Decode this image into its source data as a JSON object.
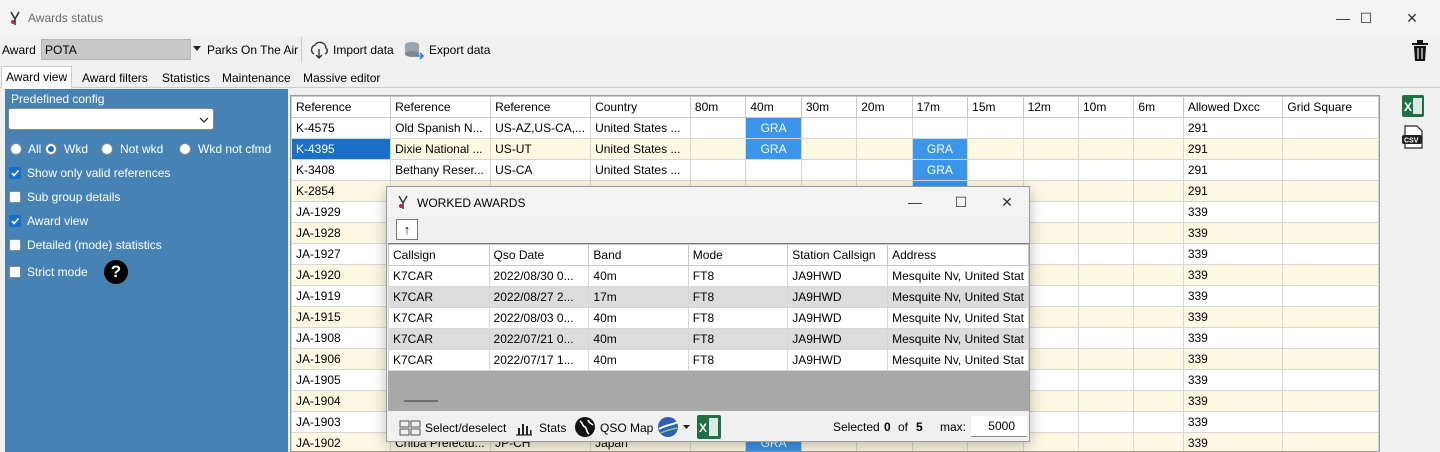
{
  "window": {
    "title": "Awards status",
    "minimize": "—",
    "maximize": "☐",
    "close": "✕"
  },
  "award_bar": {
    "label": "Award",
    "value": "POTA",
    "name": "Parks On The Air",
    "import_label": "Import data",
    "export_label": "Export data"
  },
  "tabs": [
    "Award view",
    "Award filters",
    "Statistics",
    "Maintenance",
    "Massive editor"
  ],
  "left_panel": {
    "predefined_label": "Predefined config",
    "predefined_value": "",
    "radio_all": "All",
    "radio_wkd": "Wkd",
    "radio_not_wkd": "Not wkd",
    "radio_not_cfmd": "Wkd not cfmd",
    "options": [
      {
        "label": "Show only valid references",
        "checked": true
      },
      {
        "label": "Sub group details",
        "checked": false
      },
      {
        "label": "Award view",
        "checked": true
      },
      {
        "label": "Detailed (mode) statistics",
        "checked": false
      },
      {
        "label": "Strict mode",
        "checked": false
      }
    ],
    "help_glyph": "?"
  },
  "grid": {
    "columns": [
      "Reference",
      "Reference",
      "Reference",
      "Country",
      "80m",
      "40m",
      "30m",
      "20m",
      "17m",
      "15m",
      "12m",
      "10m",
      "6m",
      "Allowed Dxcc",
      "Grid Square"
    ],
    "rows": [
      [
        "K-4575",
        "Old Spanish N...",
        "US-AZ,US-CA,...",
        "United States ...",
        "",
        "GRA",
        "",
        "",
        "",
        "",
        "",
        "",
        "",
        "291",
        ""
      ],
      [
        "K-4395",
        "Dixie National ...",
        "US-UT",
        "United States ...",
        "",
        "GRA",
        "",
        "",
        "GRA",
        "",
        "",
        "",
        "",
        "291",
        ""
      ],
      [
        "K-3408",
        "Bethany Reser...",
        "US-CA",
        "United States ...",
        "",
        "",
        "",
        "",
        "GRA",
        "",
        "",
        "",
        "",
        "291",
        ""
      ],
      [
        "K-2854",
        "",
        "",
        "",
        "",
        "",
        "",
        "",
        "GRA",
        "",
        "",
        "",
        "",
        "291",
        ""
      ],
      [
        "JA-1929",
        "",
        "",
        "",
        "",
        "",
        "",
        "",
        "",
        "",
        "",
        "",
        "",
        "339",
        ""
      ],
      [
        "JA-1928",
        "",
        "",
        "",
        "",
        "",
        "",
        "",
        "",
        "",
        "",
        "",
        "",
        "339",
        ""
      ],
      [
        "JA-1927",
        "",
        "",
        "",
        "",
        "",
        "",
        "",
        "",
        "",
        "",
        "",
        "",
        "339",
        ""
      ],
      [
        "JA-1920",
        "",
        "",
        "",
        "",
        "",
        "",
        "",
        "",
        "",
        "",
        "",
        "",
        "339",
        ""
      ],
      [
        "JA-1919",
        "",
        "",
        "",
        "",
        "",
        "",
        "",
        "",
        "",
        "",
        "",
        "",
        "339",
        ""
      ],
      [
        "JA-1915",
        "",
        "",
        "",
        "",
        "",
        "",
        "",
        "",
        "",
        "",
        "",
        "",
        "339",
        ""
      ],
      [
        "JA-1908",
        "",
        "",
        "",
        "",
        "",
        "",
        "",
        "",
        "",
        "",
        "",
        "",
        "339",
        ""
      ],
      [
        "JA-1906",
        "",
        "",
        "",
        "",
        "",
        "",
        "",
        "",
        "",
        "",
        "",
        "",
        "339",
        ""
      ],
      [
        "JA-1905",
        "",
        "",
        "",
        "",
        "",
        "",
        "",
        "",
        "",
        "",
        "",
        "",
        "339",
        ""
      ],
      [
        "JA-1904",
        "",
        "",
        "",
        "",
        "",
        "",
        "",
        "",
        "",
        "",
        "",
        "",
        "339",
        ""
      ],
      [
        "JA-1903",
        "",
        "",
        "",
        "",
        "",
        "",
        "",
        "",
        "",
        "",
        "",
        "",
        "339",
        ""
      ],
      [
        "JA-1902",
        "Chiba Prefectu...",
        "JP-CH",
        "Japan",
        "",
        "GRA",
        "",
        "",
        "",
        "",
        "",
        "",
        "",
        "339",
        ""
      ]
    ]
  },
  "dialog": {
    "title": "WORKED AWARDS",
    "sort_glyph": "↑",
    "columns": [
      "Callsign",
      "Qso Date",
      "Band",
      "Mode",
      "Station Callsign",
      "Address"
    ],
    "rows": [
      [
        "K7CAR",
        "2022/08/30 0...",
        "40m",
        "FT8",
        "JA9HWD",
        "Mesquite Nv, United Stat"
      ],
      [
        "K7CAR",
        "2022/08/27 2...",
        "17m",
        "FT8",
        "JA9HWD",
        "Mesquite Nv, United Stat"
      ],
      [
        "K7CAR",
        "2022/08/03 0...",
        "40m",
        "FT8",
        "JA9HWD",
        "Mesquite Nv, United Stat"
      ],
      [
        "K7CAR",
        "2022/07/21 0...",
        "40m",
        "FT8",
        "JA9HWD",
        "Mesquite Nv, United Stat"
      ],
      [
        "K7CAR",
        "2022/07/17 1...",
        "40m",
        "FT8",
        "JA9HWD",
        "Mesquite Nv, United Stat"
      ]
    ],
    "select_label": "Select/deselect",
    "stats_label": "Stats",
    "qso_map_label": "QSO Map",
    "selected_label": "Selected",
    "selected_count": "0",
    "of_label": "of",
    "total_count": "5",
    "max_label": "max:",
    "max_value": "5000"
  },
  "colors": {
    "panel_blue": "#4682b4",
    "gra_blue": "#3a95ec",
    "row_alt": "#fdf8e2",
    "excel_green": "#1d7044"
  },
  "icons": [
    "app-logo-icon",
    "chevron-down-icon",
    "import-icon",
    "export-icon",
    "trash-icon",
    "help-icon",
    "excel-icon",
    "csv-icon",
    "grid-select-icon",
    "stats-icon",
    "globe-icon"
  ]
}
